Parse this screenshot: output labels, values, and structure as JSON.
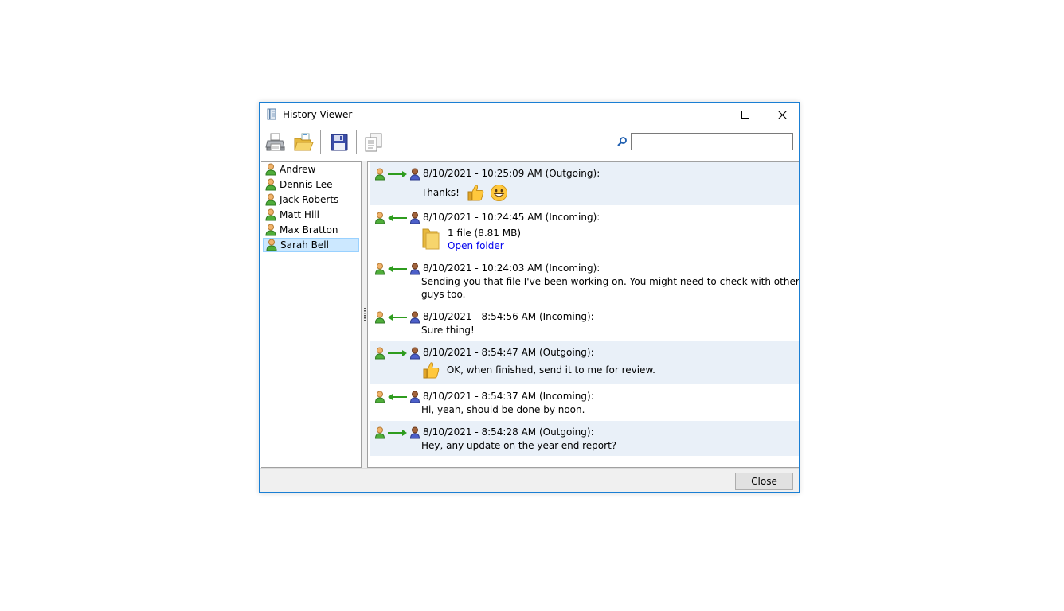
{
  "window": {
    "title": "History Viewer"
  },
  "toolbar": {
    "buttons": [
      "printer-icon",
      "open-folder-icon",
      "save-icon",
      "copy-icon"
    ],
    "search": {
      "value": "",
      "placeholder": ""
    }
  },
  "contacts": [
    {
      "name": "Andrew",
      "selected": false
    },
    {
      "name": "Dennis Lee",
      "selected": false
    },
    {
      "name": "Jack Roberts",
      "selected": false
    },
    {
      "name": "Matt Hill",
      "selected": false
    },
    {
      "name": "Max Bratton",
      "selected": false
    },
    {
      "name": "Sarah Bell",
      "selected": true
    }
  ],
  "messages": [
    {
      "header": "8/10/2021 - 10:25:09 AM (Outgoing):",
      "direction": "outgoing",
      "text": "Thanks!",
      "emoji": [
        "thumbs-up",
        "grinning-face"
      ]
    },
    {
      "header": "8/10/2021 - 10:24:45 AM (Incoming):",
      "direction": "incoming",
      "file_info": "1 file (8.81 MB)",
      "link": "Open folder"
    },
    {
      "header": "8/10/2021 - 10:24:03 AM (Incoming):",
      "direction": "incoming",
      "text_lines": [
        "Sending you that file I've been working on. You might need to check with other",
        "guys too."
      ]
    },
    {
      "header": "8/10/2021 - 8:54:56 AM (Incoming):",
      "direction": "incoming",
      "text": "Sure thing!"
    },
    {
      "header": "8/10/2021 - 8:54:47 AM (Outgoing):",
      "direction": "outgoing",
      "text": "OK, when finished, send it to me for review.",
      "emoji": [
        "thumbs-up"
      ]
    },
    {
      "header": "8/10/2021 - 8:54:37 AM (Incoming):",
      "direction": "incoming",
      "text": "Hi, yeah, should be done by noon."
    },
    {
      "header": "8/10/2021 - 8:54:28 AM (Outgoing):",
      "direction": "outgoing",
      "text": "Hey, any update on the year-end report?"
    }
  ],
  "footer": {
    "close_label": "Close"
  },
  "colors": {
    "accent_border": "#1a7fd4",
    "outgoing_bg": "#e9f0f8",
    "selected_bg": "#cce8ff",
    "link": "#0000ee",
    "arrow": "#2e9c1e"
  }
}
